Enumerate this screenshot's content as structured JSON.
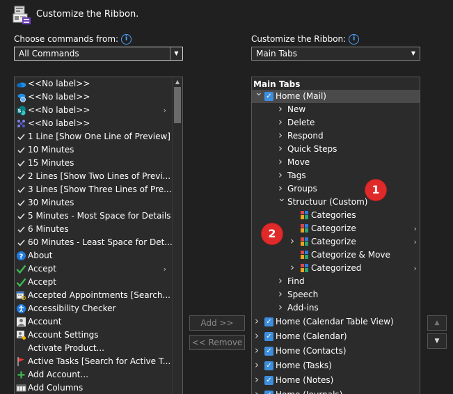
{
  "dialog": {
    "title": "Customize the Ribbon."
  },
  "left": {
    "label": "Choose commands from:",
    "label_underline": "C",
    "select_value": "All Commands",
    "items": [
      {
        "icon": "onedrive-icon",
        "text": "<<No label>>",
        "sub": false
      },
      {
        "icon": "onedrive-globe-icon",
        "text": "<<No label>>",
        "sub": false
      },
      {
        "icon": "sharepoint-icon",
        "text": "<<No label>>",
        "sub": true
      },
      {
        "icon": "teams-icon",
        "text": "<<No label>>",
        "sub": false
      },
      {
        "icon": "check-icon",
        "text": "1 Line [Show One Line of Preview]",
        "sub": false
      },
      {
        "icon": "check-icon",
        "text": "10 Minutes",
        "sub": false
      },
      {
        "icon": "check-icon",
        "text": "15 Minutes",
        "sub": false
      },
      {
        "icon": "check-icon",
        "text": "2 Lines [Show Two Lines of Previ...",
        "sub": false
      },
      {
        "icon": "check-icon",
        "text": "3 Lines [Show Three Lines of Pre...",
        "sub": false
      },
      {
        "icon": "check-icon",
        "text": "30 Minutes",
        "sub": false
      },
      {
        "icon": "check-icon",
        "text": "5 Minutes - Most Space for Details",
        "sub": false
      },
      {
        "icon": "check-icon",
        "text": "6 Minutes",
        "sub": false
      },
      {
        "icon": "check-icon",
        "text": "60 Minutes - Least Space for Det...",
        "sub": false
      },
      {
        "icon": "help-icon",
        "text": "About",
        "sub": false
      },
      {
        "icon": "accept-check-icon",
        "text": "Accept",
        "sub": true
      },
      {
        "icon": "accept-check-icon",
        "text": "Accept",
        "sub": false
      },
      {
        "icon": "calendar-search-icon",
        "text": "Accepted Appointments [Search...",
        "sub": false
      },
      {
        "icon": "accessibility-icon",
        "text": "Accessibility Checker",
        "sub": false
      },
      {
        "icon": "account-icon",
        "text": "Account",
        "sub": false
      },
      {
        "icon": "account-settings-icon",
        "text": "Account Settings",
        "sub": false
      },
      {
        "icon": "",
        "text": "Activate Product...",
        "sub": false
      },
      {
        "icon": "flag-icon",
        "text": "Active Tasks [Search for Active T...",
        "sub": false
      },
      {
        "icon": "plus-icon",
        "text": "Add Account...",
        "sub": false
      },
      {
        "icon": "columns-icon",
        "text": "Add Columns",
        "sub": false
      }
    ]
  },
  "buttons": {
    "add": "Add >>",
    "add_underline": "A",
    "remove": "<< Remove",
    "remove_underline": "R"
  },
  "right": {
    "label": "Customize the Ribbon:",
    "label_underline": "B",
    "select_value": "Main Tabs",
    "header": "Main Tabs",
    "items": [
      {
        "text": "Home (Mail)",
        "kind": "tab",
        "expanded": true
      },
      {
        "text": "New",
        "kind": "group"
      },
      {
        "text": "Delete",
        "kind": "group"
      },
      {
        "text": "Respond",
        "kind": "group"
      },
      {
        "text": "Quick Steps",
        "kind": "group"
      },
      {
        "text": "Move",
        "kind": "group"
      },
      {
        "text": "Tags",
        "kind": "group"
      },
      {
        "text": "Groups",
        "kind": "group"
      },
      {
        "text": "Structuur (Custom)",
        "kind": "custom-group"
      },
      {
        "text": "Categories",
        "kind": "cmd",
        "sub": false
      },
      {
        "text": "Categorize",
        "kind": "cmd",
        "sub": true
      },
      {
        "text": "Categorize",
        "kind": "cmd-exp",
        "sub": true
      },
      {
        "text": "Categorize & Move",
        "kind": "cmd",
        "sub": false
      },
      {
        "text": "Categorized",
        "kind": "cmd-exp",
        "sub": true
      },
      {
        "text": "Find",
        "kind": "group"
      },
      {
        "text": "Speech",
        "kind": "group"
      },
      {
        "text": "Add-ins",
        "kind": "group"
      },
      {
        "text": "Home (Calendar Table View)",
        "kind": "tab"
      },
      {
        "text": "Home (Calendar)",
        "kind": "tab"
      },
      {
        "text": "Home (Contacts)",
        "kind": "tab"
      },
      {
        "text": "Home (Tasks)",
        "kind": "tab"
      },
      {
        "text": "Home (Notes)",
        "kind": "tab"
      },
      {
        "text": "Home (Journals)",
        "kind": "tab"
      }
    ]
  },
  "annotations": [
    {
      "label": "1"
    },
    {
      "label": "2"
    }
  ],
  "colors": {
    "background": "#202020",
    "panel": "#2b2b2b",
    "accent": "#3e8ede",
    "annotation": "#e02a2a"
  }
}
